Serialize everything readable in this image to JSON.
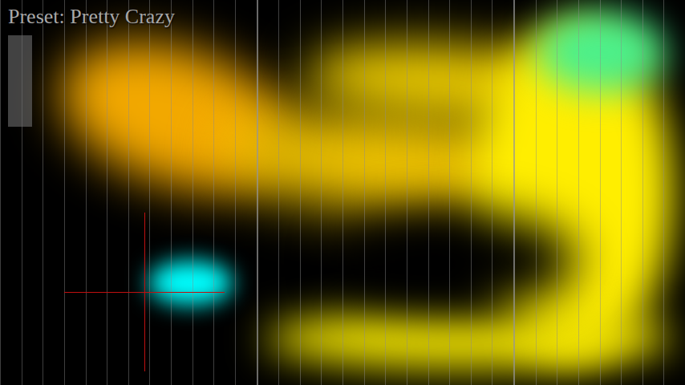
{
  "preset": {
    "label": "Preset: Pretty Crazy"
  },
  "meter": {
    "level": 1
  },
  "blobs": [
    {
      "color": "#f2a800"
    },
    {
      "color": "#f0c400"
    },
    {
      "color": "#e8c800"
    },
    {
      "color": "#ffee00"
    },
    {
      "color": "#f2e400"
    },
    {
      "color": "#000000"
    },
    {
      "color": "#4cf08a"
    },
    {
      "color": "#00ffff"
    }
  ],
  "cursor": {
    "shown": true
  }
}
